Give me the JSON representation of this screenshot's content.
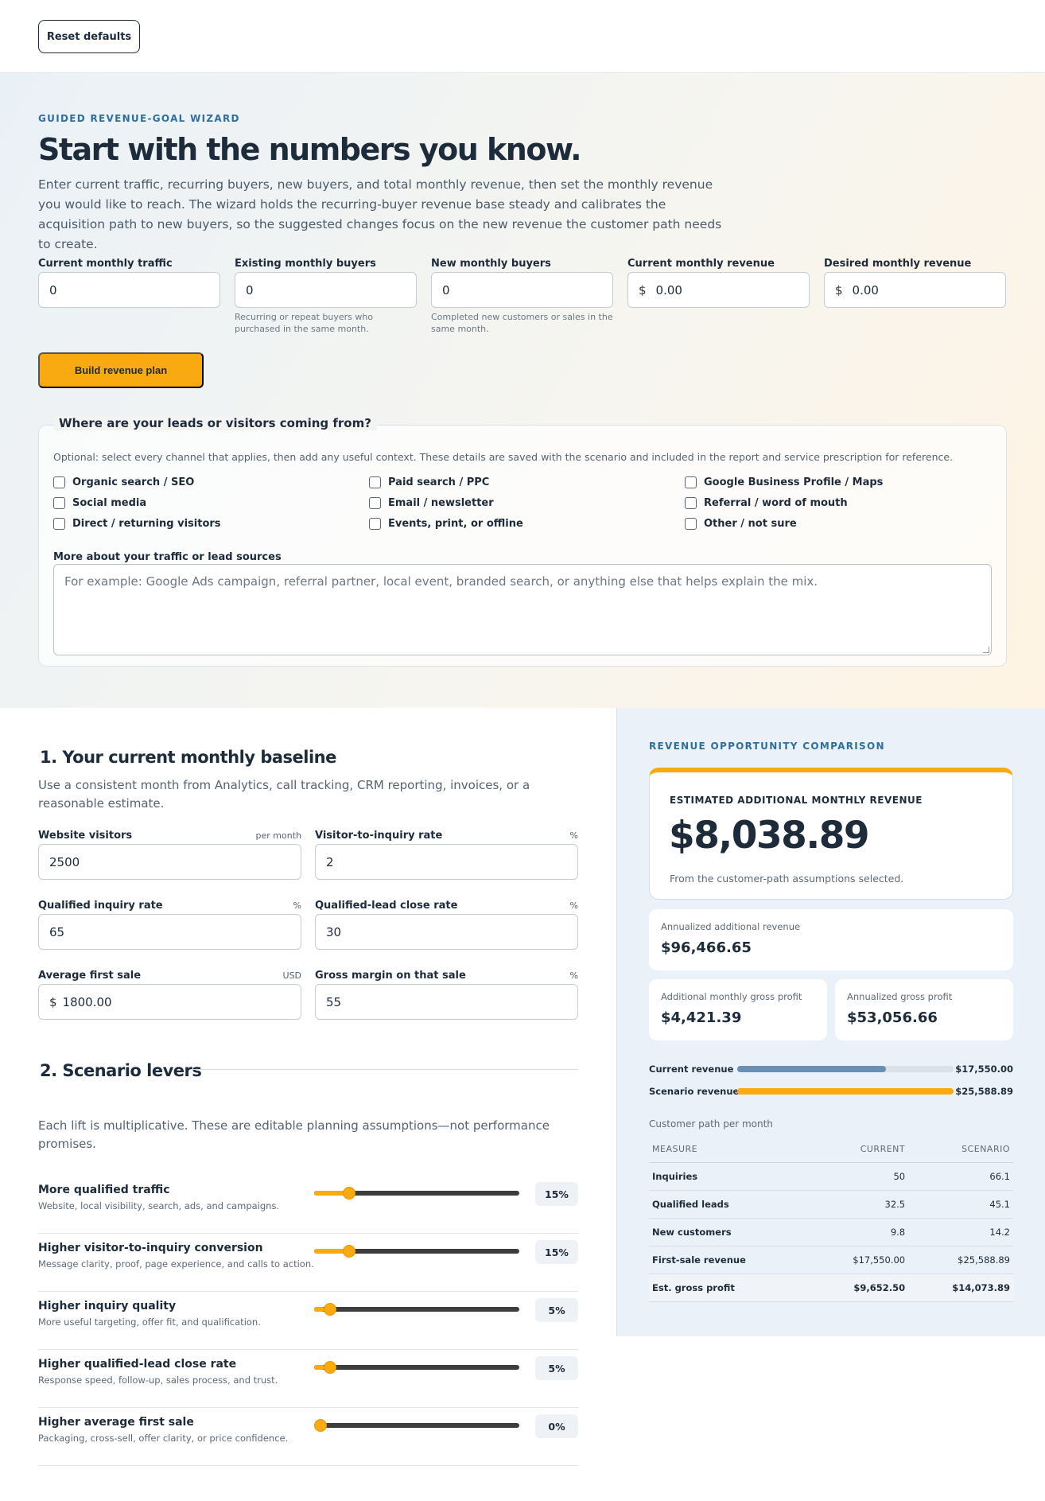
{
  "toolbar": {
    "reset_label": "Reset defaults"
  },
  "hero": {
    "eyebrow": "GUIDED REVENUE-GOAL WIZARD",
    "title": "Start with the numbers you know.",
    "description": "Enter current traffic, recurring buyers, new buyers, and total monthly revenue, then set the monthly revenue you would like to reach. The wizard holds the recurring-buyer revenue base steady and calibrates the acquisition path to new buyers, so the suggested changes focus on the new revenue the customer path needs to create.",
    "fields": [
      {
        "label": "Current monthly traffic",
        "prefix": "",
        "value": "0",
        "hint": ""
      },
      {
        "label": "Existing monthly buyers",
        "prefix": "",
        "value": "0",
        "hint": "Recurring or repeat buyers who purchased in the same month."
      },
      {
        "label": "New monthly buyers",
        "prefix": "",
        "value": "0",
        "hint": "Completed new customers or sales in the same month."
      },
      {
        "label": "Current monthly revenue",
        "prefix": "$",
        "value": "0.00",
        "hint": ""
      },
      {
        "label": "Desired monthly revenue",
        "prefix": "$",
        "value": "0.00",
        "hint": ""
      }
    ],
    "build_label": "Build revenue plan"
  },
  "sources": {
    "legend": "Where are your leads or visitors coming from?",
    "intro": "Optional: select every channel that applies, then add any useful context. These details are saved with the scenario and included in the report and service prescription for reference.",
    "options": [
      "Organic search / SEO",
      "Paid search / PPC",
      "Google Business Profile / Maps",
      "Social media",
      "Email / newsletter",
      "Referral / word of mouth",
      "Direct / returning visitors",
      "Events, print, or offline",
      "Other / not sure"
    ],
    "more_label": "More about your traffic or lead sources",
    "more_placeholder": "For example: Google Ads campaign, referral partner, local event, branded search, or anything else that helps explain the mix."
  },
  "baseline": {
    "title": "1. Your current monthly baseline",
    "description": "Use a consistent month from Analytics, call tracking, CRM reporting, invoices, or a reasonable estimate.",
    "fields": [
      {
        "label": "Website visitors",
        "unit": "per month",
        "prefix": "",
        "value": "2500"
      },
      {
        "label": "Visitor-to-inquiry rate",
        "unit": "%",
        "prefix": "",
        "value": "2"
      },
      {
        "label": "Qualified inquiry rate",
        "unit": "%",
        "prefix": "",
        "value": "65"
      },
      {
        "label": "Qualified-lead close rate",
        "unit": "%",
        "prefix": "",
        "value": "30"
      },
      {
        "label": "Average first sale",
        "unit": "USD",
        "prefix": "$",
        "value": "1800.00"
      },
      {
        "label": "Gross margin on that sale",
        "unit": "%",
        "prefix": "",
        "value": "55"
      }
    ]
  },
  "levers": {
    "title": "2. Scenario levers",
    "description": "Each lift is multiplicative. These are editable planning assumptions—not performance promises.",
    "slider_max_percent": 100,
    "items": [
      {
        "title": "More qualified traffic",
        "subtitle": "Website, local visibility, search, ads, and campaigns.",
        "value": 15,
        "label": "15%"
      },
      {
        "title": "Higher visitor-to-inquiry conversion",
        "subtitle": "Message clarity, proof, page experience, and calls to action.",
        "value": 15,
        "label": "15%"
      },
      {
        "title": "Higher inquiry quality",
        "subtitle": "More useful targeting, offer fit, and qualification.",
        "value": 5,
        "label": "5%"
      },
      {
        "title": "Higher qualified-lead close rate",
        "subtitle": "Response speed, follow-up, sales process, and trust.",
        "value": 5,
        "label": "5%"
      },
      {
        "title": "Higher average first sale",
        "subtitle": "Packaging, cross-sell, offer clarity, or price confidence.",
        "value": 0,
        "label": "0%"
      }
    ]
  },
  "comparison": {
    "eyebrow": "REVENUE OPPORTUNITY COMPARISON",
    "estimate_label": "ESTIMATED ADDITIONAL MONTHLY REVENUE",
    "estimate_value": "$8,038.89",
    "estimate_note": "From the customer-path assumptions selected.",
    "annualized_label": "Annualized additional revenue",
    "annualized_value": "$96,466.65",
    "gp_monthly_label": "Additional monthly gross profit",
    "gp_monthly_value": "$4,421.39",
    "gp_annual_label": "Annualized gross profit",
    "gp_annual_value": "$53,056.66",
    "bars": [
      {
        "label": "Current revenue",
        "value": 17550.0,
        "display": "$17,550.00",
        "color": "#6a8fb3"
      },
      {
        "label": "Scenario revenue",
        "value": 25588.89,
        "display": "$25,588.89",
        "color": "#f8aa10"
      }
    ],
    "path_caption": "Customer path per month",
    "table": {
      "headers": [
        "MEASURE",
        "CURRENT",
        "SCENARIO"
      ],
      "rows": [
        [
          "Inquiries",
          "50",
          "66.1"
        ],
        [
          "Qualified leads",
          "32.5",
          "45.1"
        ],
        [
          "New customers",
          "9.8",
          "14.2"
        ],
        [
          "First-sale revenue",
          "$17,550.00",
          "$25,588.89"
        ],
        [
          "Est. gross profit",
          "$9,652.50",
          "$14,073.89"
        ]
      ]
    }
  },
  "colors": {
    "accent": "#f8aa10",
    "eyebrow": "#2e6f9e",
    "text": "#1d2b3a"
  }
}
